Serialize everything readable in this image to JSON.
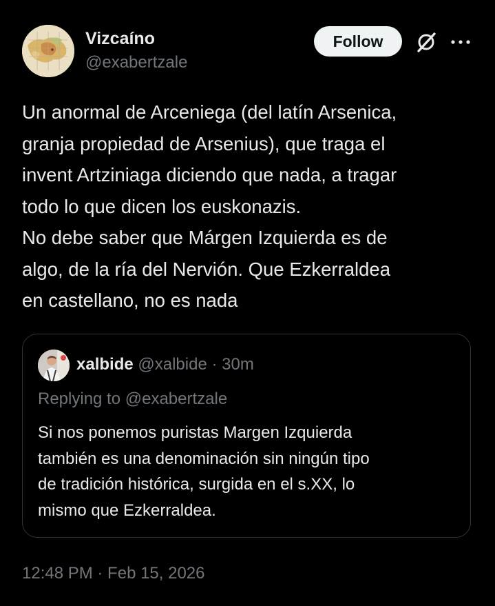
{
  "author": {
    "display_name": "Vizcaíno",
    "handle": "@exabertzale",
    "avatar": "map-avatar"
  },
  "actions": {
    "follow_label": "Follow",
    "grok_icon": "grok-icon",
    "more_icon": "more-horizontal-icon"
  },
  "tweet": {
    "text": "Un anormal de Arceniega (del latín Arsenica,\ngranja propiedad de Arsenius), que traga el\ninvent Artziniaga diciendo que nada, a tragar\ntodo lo que dicen los euskonazis.\nNo debe saber que Márgen Izquierda es de\nalgo, de la ría del Nervión. Que Ezkerraldea\nen castellano, no es nada",
    "timestamp": "12:48 PM · Feb 15, 2026"
  },
  "quoted_tweet": {
    "display_name": "xalbide",
    "handle": "@xalbide",
    "separator": "·",
    "time": "30m",
    "replying_to": "Replying to @exabertzale",
    "text": "Si nos ponemos puristas Margen Izquierda\ntambién es una denominación sin ningún tipo\nde tradición histórica, surgida en el s.XX, lo\nmismo que Ezkerraldea."
  },
  "colors": {
    "background": "#000000",
    "primary_text": "#e7e9ea",
    "secondary_text": "#71767b",
    "border": "#2f3336",
    "follow_bg": "#eff3f4"
  }
}
